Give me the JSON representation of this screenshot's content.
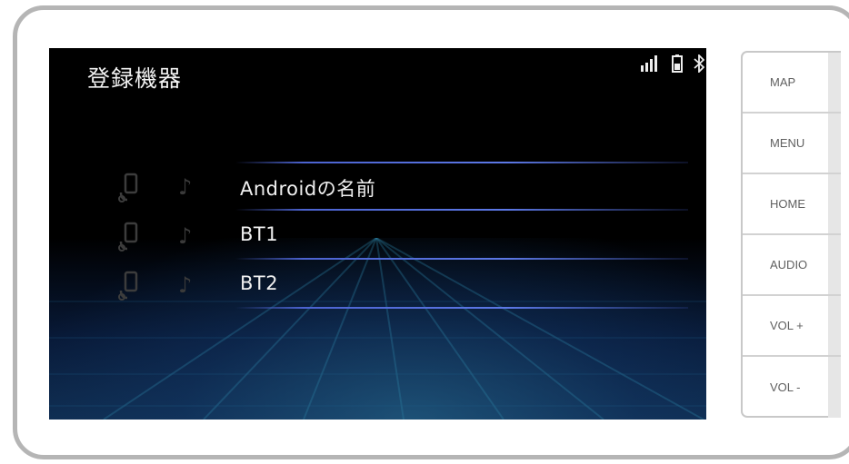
{
  "screen": {
    "title": "登録機器",
    "status_icons": [
      "signal-icon",
      "battery-icon",
      "bluetooth-icon"
    ]
  },
  "devices": [
    {
      "label": "Androidの名前",
      "icons": [
        "phone-icon",
        "music-note-icon"
      ]
    },
    {
      "label": "BT1",
      "icons": [
        "phone-icon",
        "music-note-icon"
      ]
    },
    {
      "label": "BT2",
      "icons": [
        "phone-icon",
        "music-note-icon"
      ]
    }
  ],
  "side_buttons": [
    {
      "label": "MAP"
    },
    {
      "label": "MENU"
    },
    {
      "label": "HOME"
    },
    {
      "label": "AUDIO"
    },
    {
      "label": "VOL +"
    },
    {
      "label": "VOL -"
    }
  ],
  "colors": {
    "screen_bg": "#000000",
    "divider": "#5c78e6",
    "text": "#f0f0f0",
    "side_text": "#606060",
    "bezel": "#b5b5b5"
  }
}
